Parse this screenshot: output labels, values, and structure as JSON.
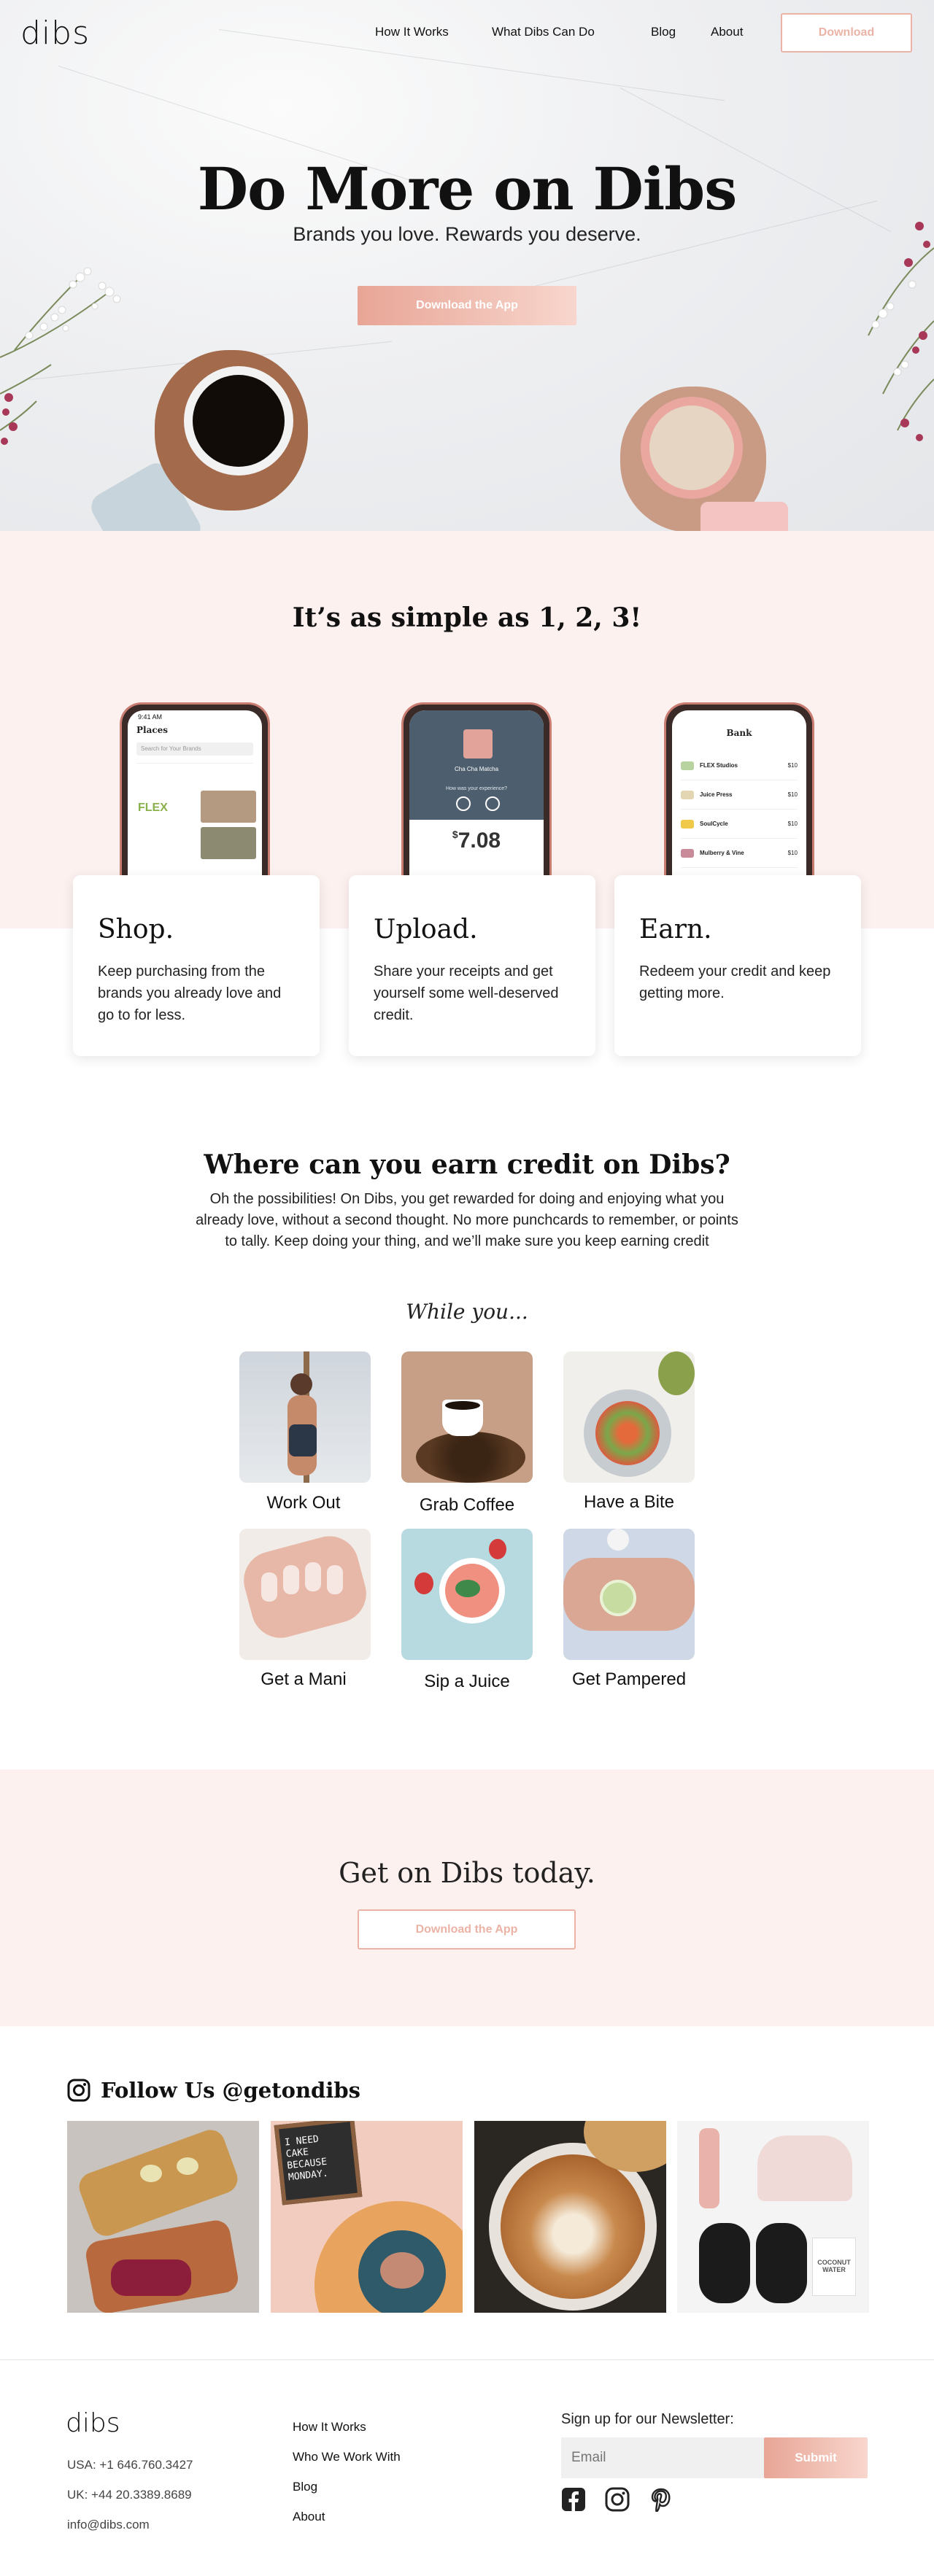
{
  "header": {
    "logo": "dibs",
    "nav": [
      "How It Works",
      "What Dibs Can Do",
      "Blog",
      "About"
    ],
    "download_label": "Download"
  },
  "hero": {
    "title": "Do More on Dibs",
    "subtitle": "Brands you love. Rewards you deserve.",
    "cta_label": "Download the App"
  },
  "steps": {
    "title": "It’s as simple as 1, 2, 3!",
    "cards": [
      {
        "heading": "Shop.",
        "text": "Keep purchasing from the brands you already love and go to for less."
      },
      {
        "heading": "Upload.",
        "text": "Share your receipts and get yourself some well-deserved credit."
      },
      {
        "heading": "Earn.",
        "text": "Redeem your credit and keep getting more."
      }
    ],
    "phones": {
      "places": {
        "title": "Places",
        "search_placeholder": "Search for Your Brands",
        "brand": "FLEX"
      },
      "upload": {
        "brand": "Cha Cha Matcha",
        "question": "How was your experience?",
        "amount": "7.08",
        "currency": "$"
      },
      "bank": {
        "title": "Bank",
        "rows": [
          {
            "name": "FLEX Studios",
            "value": "$10"
          },
          {
            "name": "Juice Press",
            "value": "$10"
          },
          {
            "name": "SoulCycle",
            "value": "$10"
          },
          {
            "name": "Mulberry & Vine",
            "value": "$10"
          }
        ]
      }
    }
  },
  "earn": {
    "title": "Where can you earn credit on Dibs?",
    "lines": [
      "Oh the possibilities! On Dibs, you get rewarded for doing and enjoying what you",
      "already love, without a second thought. No more punchcards to remember, or points",
      "to tally. Keep doing your thing, and we’ll make sure you keep earning credit"
    ],
    "while_you": "While you...",
    "activities": [
      "Work Out",
      "Grab Coffee",
      "Have a Bite",
      "Get a Mani",
      "Sip a Juice",
      "Get Pampered"
    ]
  },
  "cta": {
    "title": "Get on Dibs today.",
    "button_label": "Download the App"
  },
  "instagram": {
    "title": "Follow Us @getondibs",
    "chalkboard_text": "I NEED CAKE BECAUSE MONDAY.",
    "bottle_label": "COCONUT WATER"
  },
  "footer": {
    "logo": "dibs",
    "contacts": [
      "USA: +1 646.760.3427",
      "UK: +44 20.3389.8689",
      "info@dibs.com"
    ],
    "links": [
      "How It Works",
      "Who We Work With",
      "Blog",
      "About"
    ],
    "newsletter_label": "Sign up for our Newsletter:",
    "email_placeholder": "Email",
    "submit_label": "Submit",
    "social_icons": [
      "facebook-icon",
      "instagram-icon",
      "pinterest-icon"
    ]
  },
  "colors": {
    "accent": "#ebb3a6",
    "pink_band": "#fdf1ef",
    "text": "#111111"
  }
}
